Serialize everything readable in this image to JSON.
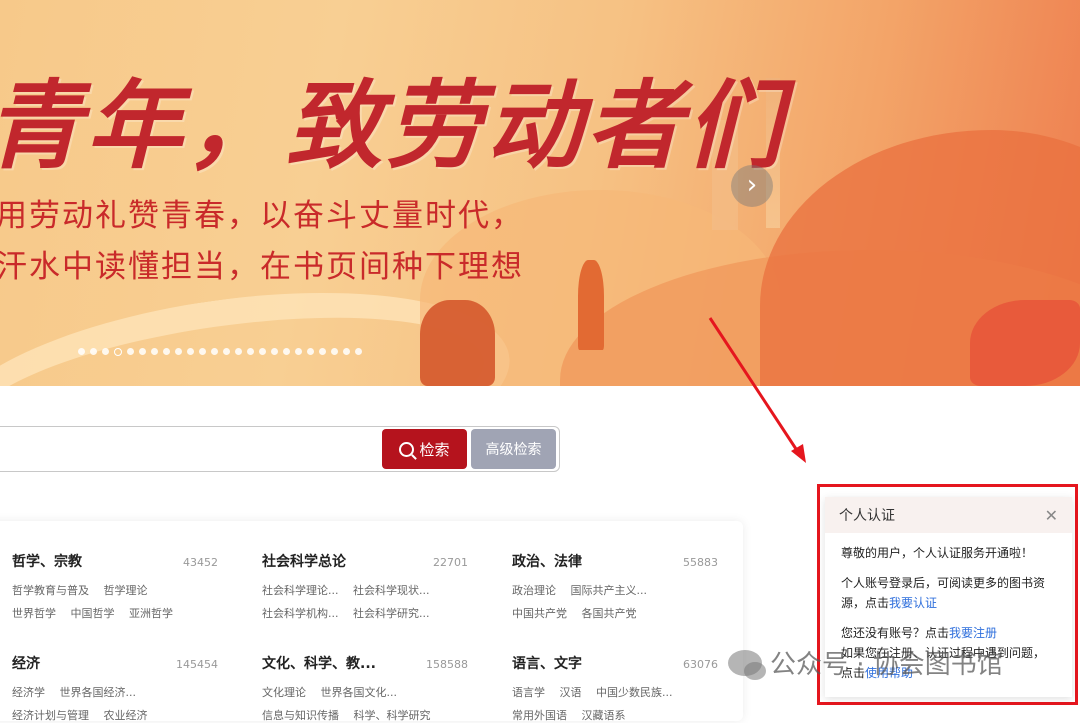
{
  "banner": {
    "title": "青年，致劳动者们",
    "line1": "用劳动礼赞青春，以奋斗丈量时代，",
    "line2": "汗水中读懂担当，在书页间种下理想",
    "slide_count": 24,
    "active_slide": 3,
    "next_icon": "chevron-right-icon"
  },
  "search": {
    "input_value": "",
    "search_label": "检索",
    "advanced_label": "高级检索",
    "search_icon": "search-icon"
  },
  "categories": [
    {
      "name": "哲学、宗教",
      "count": "43452",
      "rows": [
        [
          "哲学教育与普及",
          "哲学理论"
        ],
        [
          "世界哲学",
          "中国哲学",
          "亚洲哲学"
        ]
      ]
    },
    {
      "name": "社会科学总论",
      "count": "22701",
      "rows": [
        [
          "社会科学理论...",
          "社会科学现状..."
        ],
        [
          "社会科学机构...",
          "社会科学研究..."
        ]
      ]
    },
    {
      "name": "政治、法律",
      "count": "55883",
      "rows": [
        [
          "政治理论",
          "国际共产主义..."
        ],
        [
          "中国共产党",
          "各国共产党"
        ]
      ]
    },
    {
      "name": "经济",
      "count": "145454",
      "rows": [
        [
          "经济学",
          "世界各国经济..."
        ],
        [
          "经济计划与管理",
          "农业经济"
        ]
      ]
    },
    {
      "name": "文化、科学、教...",
      "count": "158588",
      "rows": [
        [
          "文化理论",
          "世界各国文化..."
        ],
        [
          "信息与知识传播",
          "科学、科学研究"
        ]
      ]
    },
    {
      "name": "语言、文字",
      "count": "63076",
      "rows": [
        [
          "语言学",
          "汉语",
          "中国少数民族..."
        ],
        [
          "常用外国语",
          "汉藏语系"
        ]
      ]
    }
  ],
  "popup": {
    "title": "个人认证",
    "close_icon": "close-icon",
    "greeting": "尊敬的用户，个人认证服务开通啦！",
    "login_text": "个人账号登录后，可阅读更多的图书资源，点击",
    "login_link": "我要认证",
    "register_text": "您还没有账号？点击",
    "register_link": "我要注册",
    "help_text": "如果您在注册、认证过程中遇到问题，点击",
    "help_link": "使用帮助"
  },
  "watermark": {
    "text": "公众号 · 协会图书馆",
    "icon": "wechat-icon"
  },
  "colors": {
    "primary_red": "#b5131d",
    "annotation_red": "#e5161e",
    "link_blue": "#2f6fdc",
    "advanced_gray": "#a0a4b4"
  }
}
